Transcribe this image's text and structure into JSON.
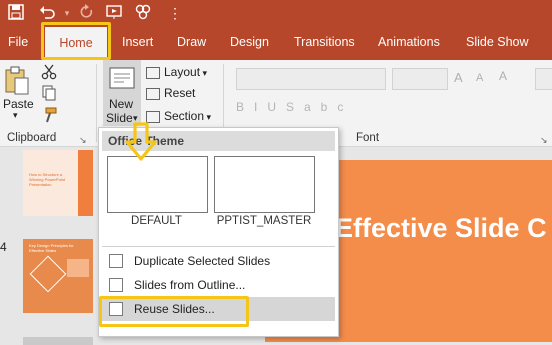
{
  "qat": {
    "save_icon": "save-icon",
    "undo_icon": "undo-icon",
    "redo_icon": "redo-icon",
    "present_icon": "present-from-start-icon",
    "more_icon": "more-icon"
  },
  "tabs": [
    "File",
    "Home",
    "Insert",
    "Draw",
    "Design",
    "Transitions",
    "Animations",
    "Slide Show"
  ],
  "ribbon": {
    "paste_label": "Paste",
    "new_slide_line1": "New",
    "new_slide_line2": "Slide",
    "layout_label": "Layout",
    "reset_label": "Reset",
    "section_label": "Section",
    "clipboard_label": "Clipboard",
    "font_label": "Font"
  },
  "menu": {
    "theme_header": "Office Theme",
    "layouts": [
      "DEFAULT",
      "PPTIST_MASTER"
    ],
    "items": [
      "Duplicate Selected Slides",
      "Slides from Outline...",
      "Reuse Slides..."
    ]
  },
  "thumbnails": {
    "slide4_number": "4",
    "slide_text_a": "How to Structure a Winning PowerPoint Presentation",
    "slide_text_b": "Key Design Principles for Effective Slides"
  },
  "canvas": {
    "title_fragment": "Effective Slide C"
  },
  "colors": {
    "accent": "#b7472a",
    "highlight": "#f5c518",
    "slide_orange": "#f48c4a"
  }
}
